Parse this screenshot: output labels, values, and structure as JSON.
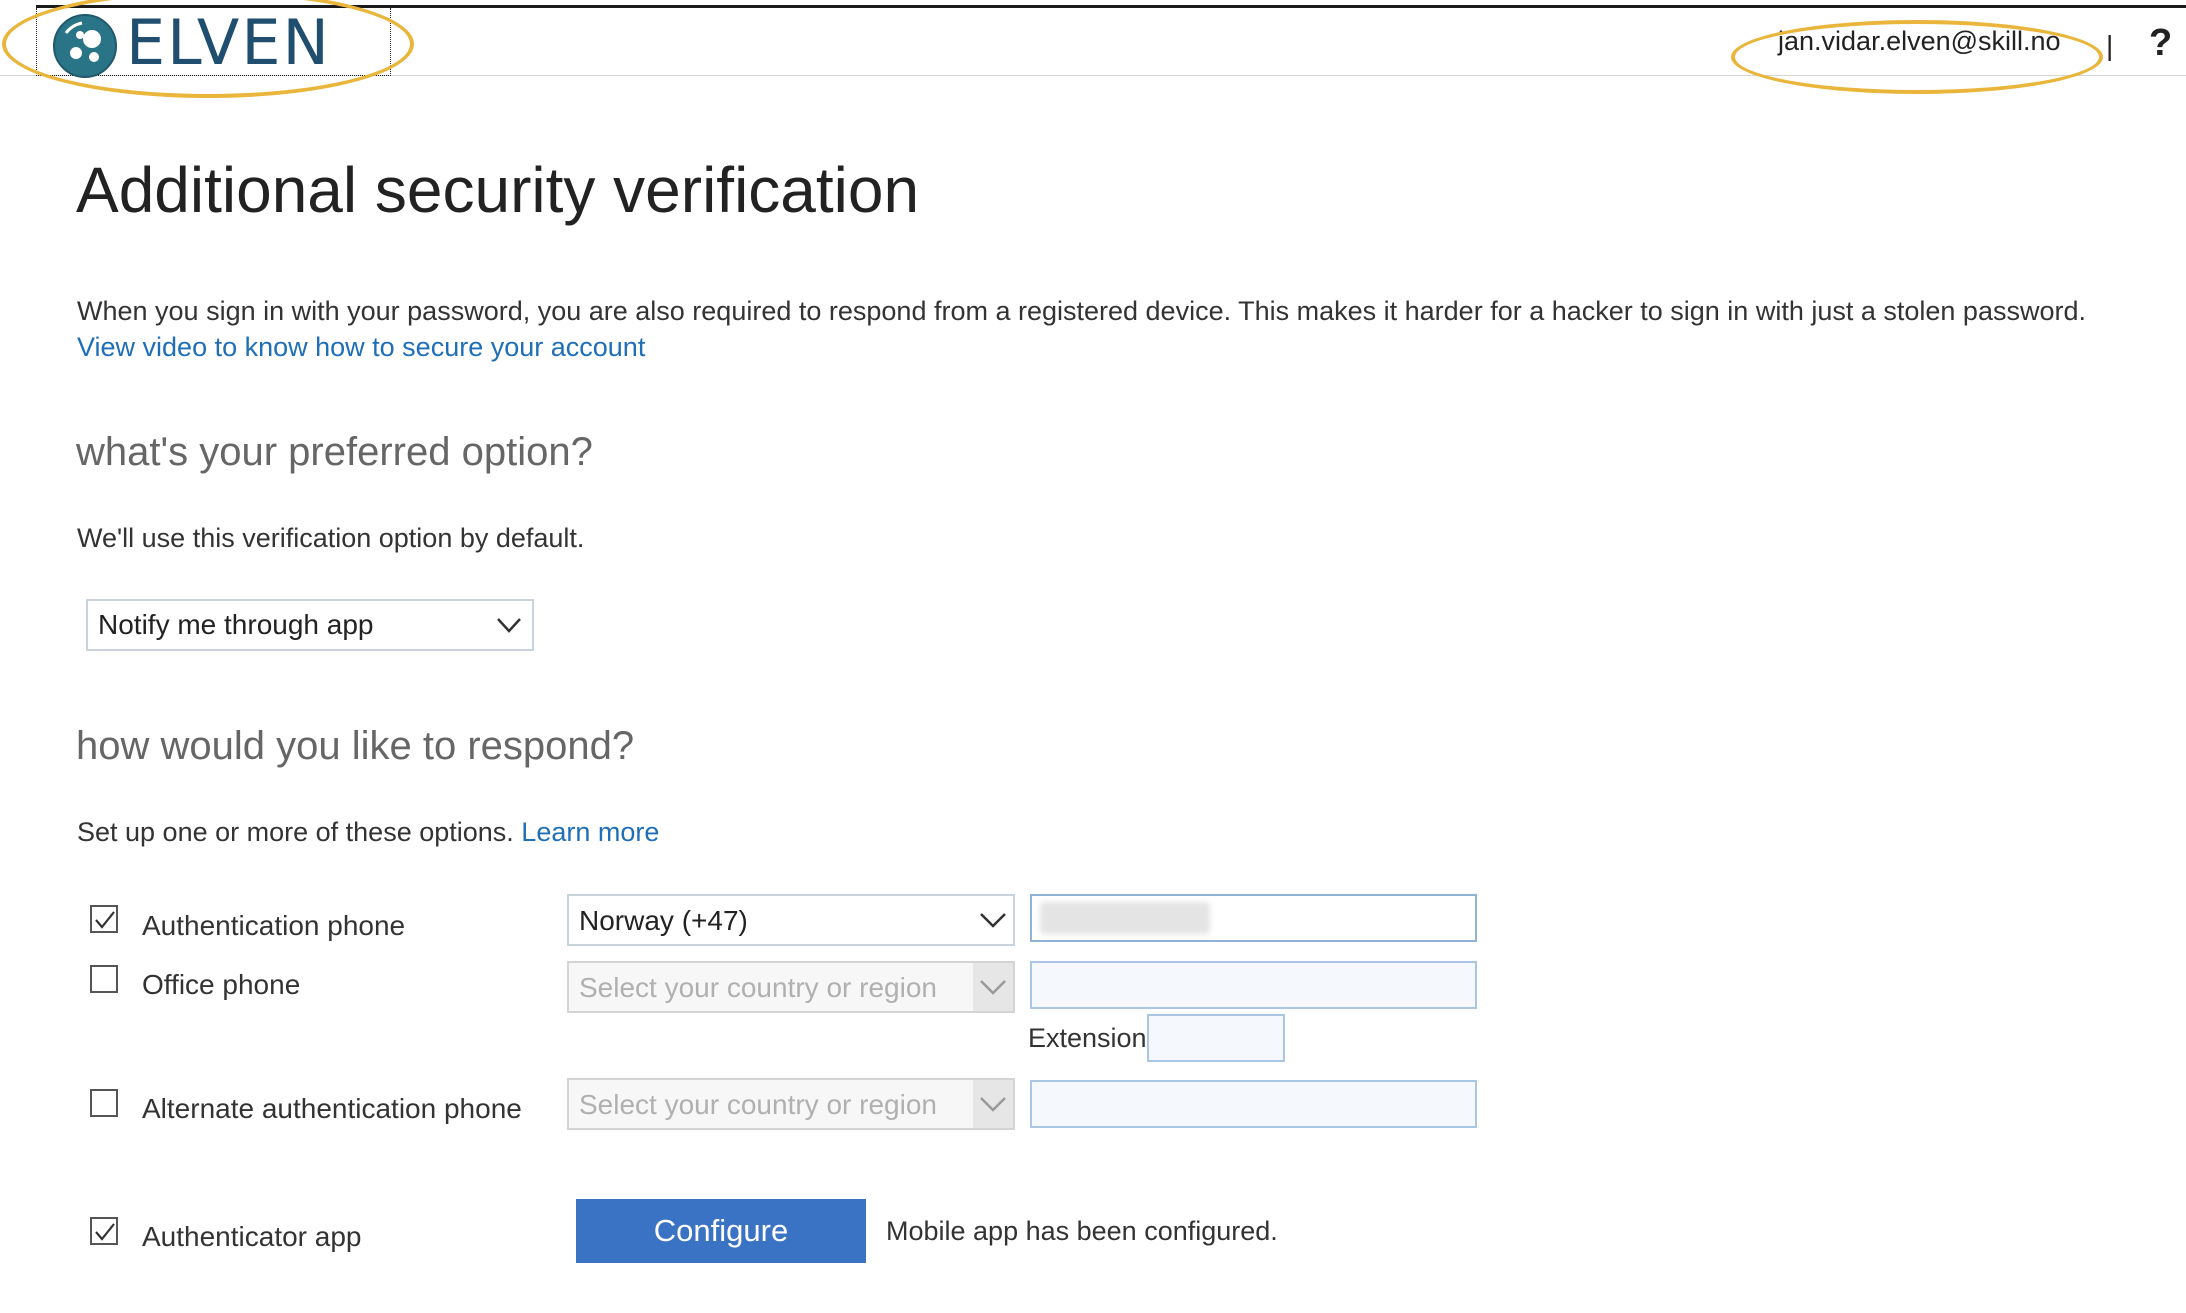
{
  "header": {
    "logo_text": "ELVEN",
    "user_email": "jan.vidar.elven@skill.no",
    "separator": "|",
    "help_label": "?"
  },
  "page": {
    "title": "Additional security verification",
    "intro": "When you sign in with your password, you are also required to respond from a registered device. This makes it harder for a hacker to sign in with just a stolen password.",
    "video_link": "View video to know how to secure your account"
  },
  "preferred": {
    "heading": "what's your preferred option?",
    "description": "We'll use this verification option by default.",
    "selected": "Notify me through app"
  },
  "respond": {
    "heading": "how would you like to respond?",
    "description": "Set up one or more of these options.",
    "learn_more": "Learn more"
  },
  "options": {
    "auth_phone": {
      "label": "Authentication phone",
      "checked": true,
      "country": "Norway (+47)"
    },
    "office_phone": {
      "label": "Office phone",
      "checked": false,
      "country_placeholder": "Select your country or region",
      "extension_label": "Extension"
    },
    "alt_phone": {
      "label": "Alternate authentication phone",
      "checked": false,
      "country_placeholder": "Select your country or region"
    },
    "auth_app": {
      "label": "Authenticator app",
      "checked": true,
      "button": "Configure",
      "status": "Mobile app has been configured."
    }
  },
  "colors": {
    "link": "#1e6fb8",
    "button": "#3a73c3",
    "highlight": "#e9b53b"
  },
  "icons": [
    "elven-logo-icon",
    "help-icon",
    "chevron-down-icon",
    "checkbox-icon"
  ]
}
